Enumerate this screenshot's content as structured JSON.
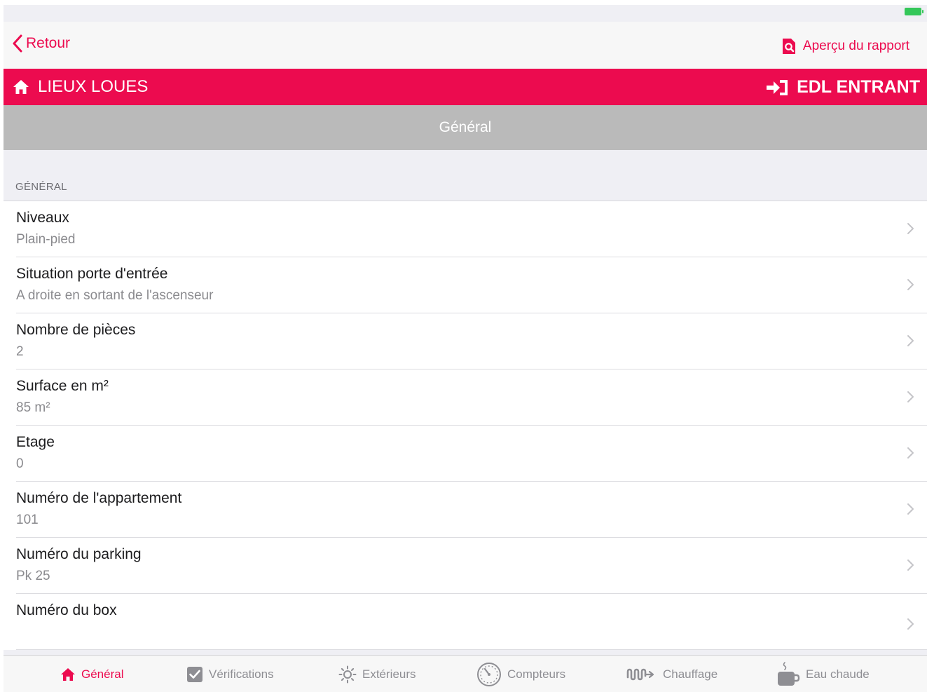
{
  "status_bar": {
    "left_text": "",
    "right_text": ""
  },
  "nav": {
    "back_label": "Retour",
    "preview_label": "Aperçu du rapport"
  },
  "header": {
    "left_label": "LIEUX LOUES",
    "right_label": "EDL ENTRANT",
    "accent_color": "#ec0b4f"
  },
  "section_title": "Général",
  "group_title": "GÉNÉRAL",
  "rows": [
    {
      "title": "Niveaux",
      "value": "Plain-pied"
    },
    {
      "title": "Situation porte d'entrée",
      "value": "A droite en sortant de l'ascenseur"
    },
    {
      "title": "Nombre de pièces",
      "value": "2"
    },
    {
      "title": "Surface en m²",
      "value": "85 m²"
    },
    {
      "title": "Etage",
      "value": "0"
    },
    {
      "title": "Numéro de l'appartement",
      "value": "101"
    },
    {
      "title": "Numéro du parking",
      "value": "Pk 25"
    },
    {
      "title": "Numéro du box",
      "value": ""
    }
  ],
  "tabs": [
    {
      "label": "Général",
      "icon": "home-icon",
      "active": true
    },
    {
      "label": "Vérifications",
      "icon": "checkbox-icon",
      "active": false
    },
    {
      "label": "Extérieurs",
      "icon": "sun-icon",
      "active": false
    },
    {
      "label": "Compteurs",
      "icon": "gauge-icon",
      "active": false
    },
    {
      "label": "Chauffage",
      "icon": "radiator-icon",
      "active": false
    },
    {
      "label": "Eau chaude",
      "icon": "hot-water-icon",
      "active": false
    }
  ]
}
